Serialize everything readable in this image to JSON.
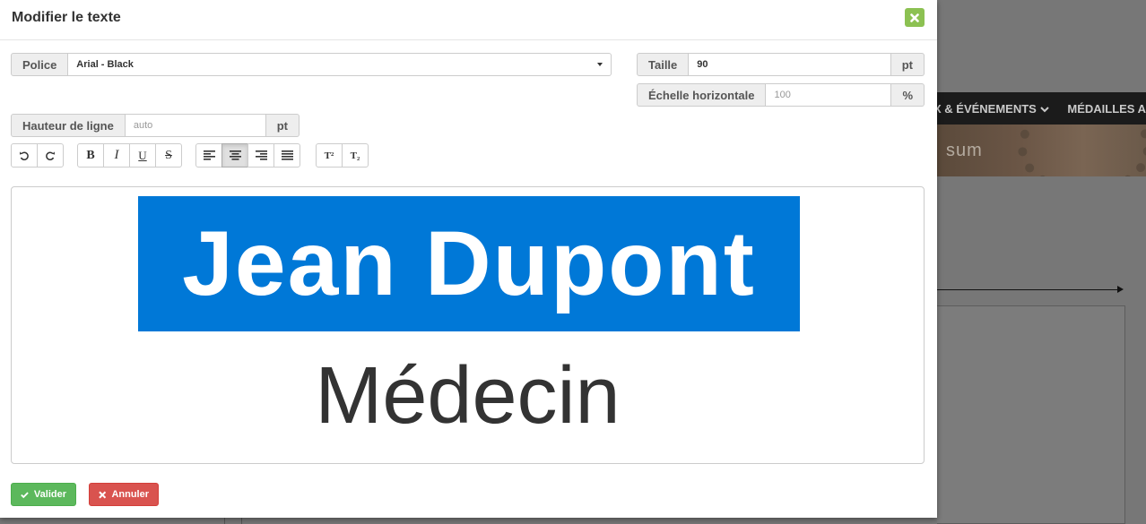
{
  "background": {
    "nav_item_1": "X & ÉVÉNEMENTS",
    "nav_item_2": "MÉDAILLES A",
    "banner_text": "sum"
  },
  "modal": {
    "title": "Modifier le texte",
    "close_icon": "close-icon"
  },
  "fields": {
    "font_label": "Police",
    "font_value": "Arial - Black",
    "size_label": "Taille",
    "size_value": "90",
    "size_unit": "pt",
    "hscale_label": "Échelle horizontale",
    "hscale_placeholder": "100",
    "hscale_unit": "%",
    "lineheight_label": "Hauteur de ligne",
    "lineheight_placeholder": "auto",
    "lineheight_unit": "pt"
  },
  "toolbar": {
    "undo_icon": "undo-icon",
    "redo_icon": "redo-icon",
    "bold_label": "B",
    "italic_label": "I",
    "underline_label": "U",
    "strike_label": "S",
    "align_left_icon": "align-left-icon",
    "align_center_icon": "align-center-icon",
    "align_right_icon": "align-right-icon",
    "align_justify_icon": "align-justify-icon",
    "active_alignment": "center",
    "superscript_label": "T²",
    "subscript_label": "T₂"
  },
  "editor": {
    "line1": "Jean Dupont",
    "line1_highlight_color": "#0078d7",
    "line2": "Médecin"
  },
  "footer": {
    "validate_label": "Valider",
    "validate_color": "#5cb85c",
    "cancel_label": "Annuler",
    "cancel_color": "#d9534f"
  }
}
